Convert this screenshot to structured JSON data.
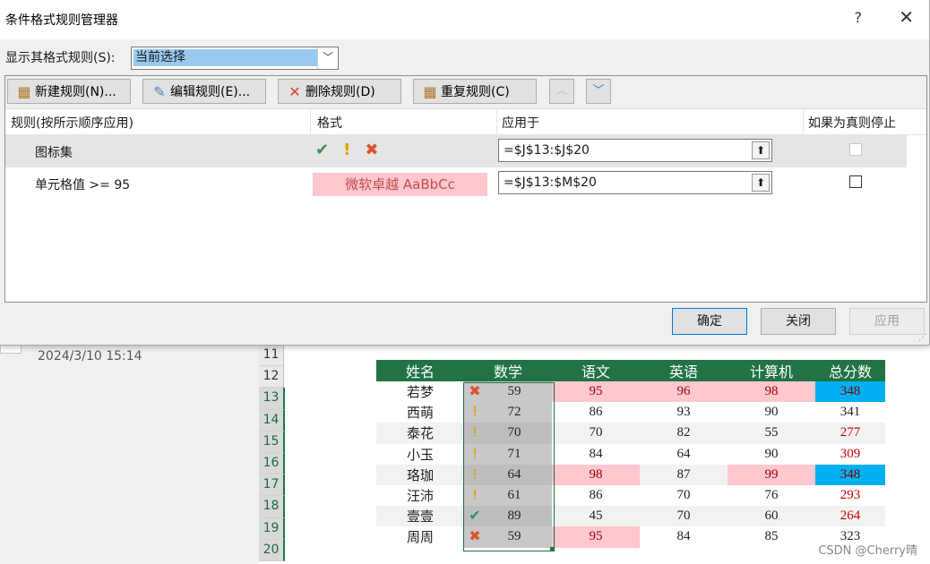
{
  "dialog": {
    "title": "条件格式规则管理器",
    "help": "?",
    "close": "✕",
    "show_label": "显示其格式规则(S):",
    "show_value": "当前选择",
    "toolbar": {
      "new": "新建规则(N)...",
      "edit": "编辑规则(E)...",
      "delete": "删除规则(D)",
      "duplicate": "重复规则(C)"
    },
    "columns": {
      "rule": "规则(按所示顺序应用)",
      "format": "格式",
      "applies": "应用于",
      "stop": "如果为真则停止"
    },
    "rules": [
      {
        "name": "图标集",
        "applies": "=$J$13:$J$20"
      },
      {
        "name": "单元格值 >= 95",
        "preview": "微软卓越  AaBbCc",
        "applies": "=$J$13:$M$20"
      }
    ],
    "buttons": {
      "ok": "确定",
      "close": "关闭",
      "apply": "应用"
    }
  },
  "background": {
    "timestamp": "2024/3/10 15:14",
    "watermark": "CSDN @Cherry晴",
    "row_numbers": [
      "11",
      "12",
      "13",
      "14",
      "15",
      "16",
      "17",
      "18",
      "19",
      "20"
    ],
    "headers": [
      "姓名",
      "数学",
      "语文",
      "英语",
      "计算机",
      "总分数"
    ],
    "rows": [
      {
        "name": "若梦",
        "icon": "x-icon",
        "math": "59",
        "chinese": "95",
        "english": "96",
        "computer": "98",
        "total": "348"
      },
      {
        "name": "西萌",
        "icon": "exclaim-icon",
        "math": "72",
        "chinese": "86",
        "english": "93",
        "computer": "90",
        "total": "341"
      },
      {
        "name": "泰花",
        "icon": "exclaim-icon",
        "math": "70",
        "chinese": "70",
        "english": "82",
        "computer": "55",
        "total": "277"
      },
      {
        "name": "小玉",
        "icon": "exclaim-icon",
        "math": "71",
        "chinese": "84",
        "english": "64",
        "computer": "90",
        "total": "309"
      },
      {
        "name": "珞珈",
        "icon": "exclaim-icon",
        "math": "64",
        "chinese": "98",
        "english": "87",
        "computer": "99",
        "total": "348"
      },
      {
        "name": "汪沛",
        "icon": "exclaim-icon",
        "math": "61",
        "chinese": "86",
        "english": "70",
        "computer": "76",
        "total": "293"
      },
      {
        "name": "壹壹",
        "icon": "check-icon",
        "math": "89",
        "chinese": "45",
        "english": "70",
        "computer": "60",
        "total": "264"
      },
      {
        "name": "周周",
        "icon": "x-icon",
        "math": "59",
        "chinese": "95",
        "english": "84",
        "computer": "85",
        "total": "323"
      }
    ]
  },
  "colors": {
    "accent": "#217346",
    "pink_fill": "#ffc7ce",
    "blue_fill": "#00b0f0",
    "check": "#3a8f5c",
    "exclaim": "#e0a000",
    "x": "#d9532b"
  }
}
